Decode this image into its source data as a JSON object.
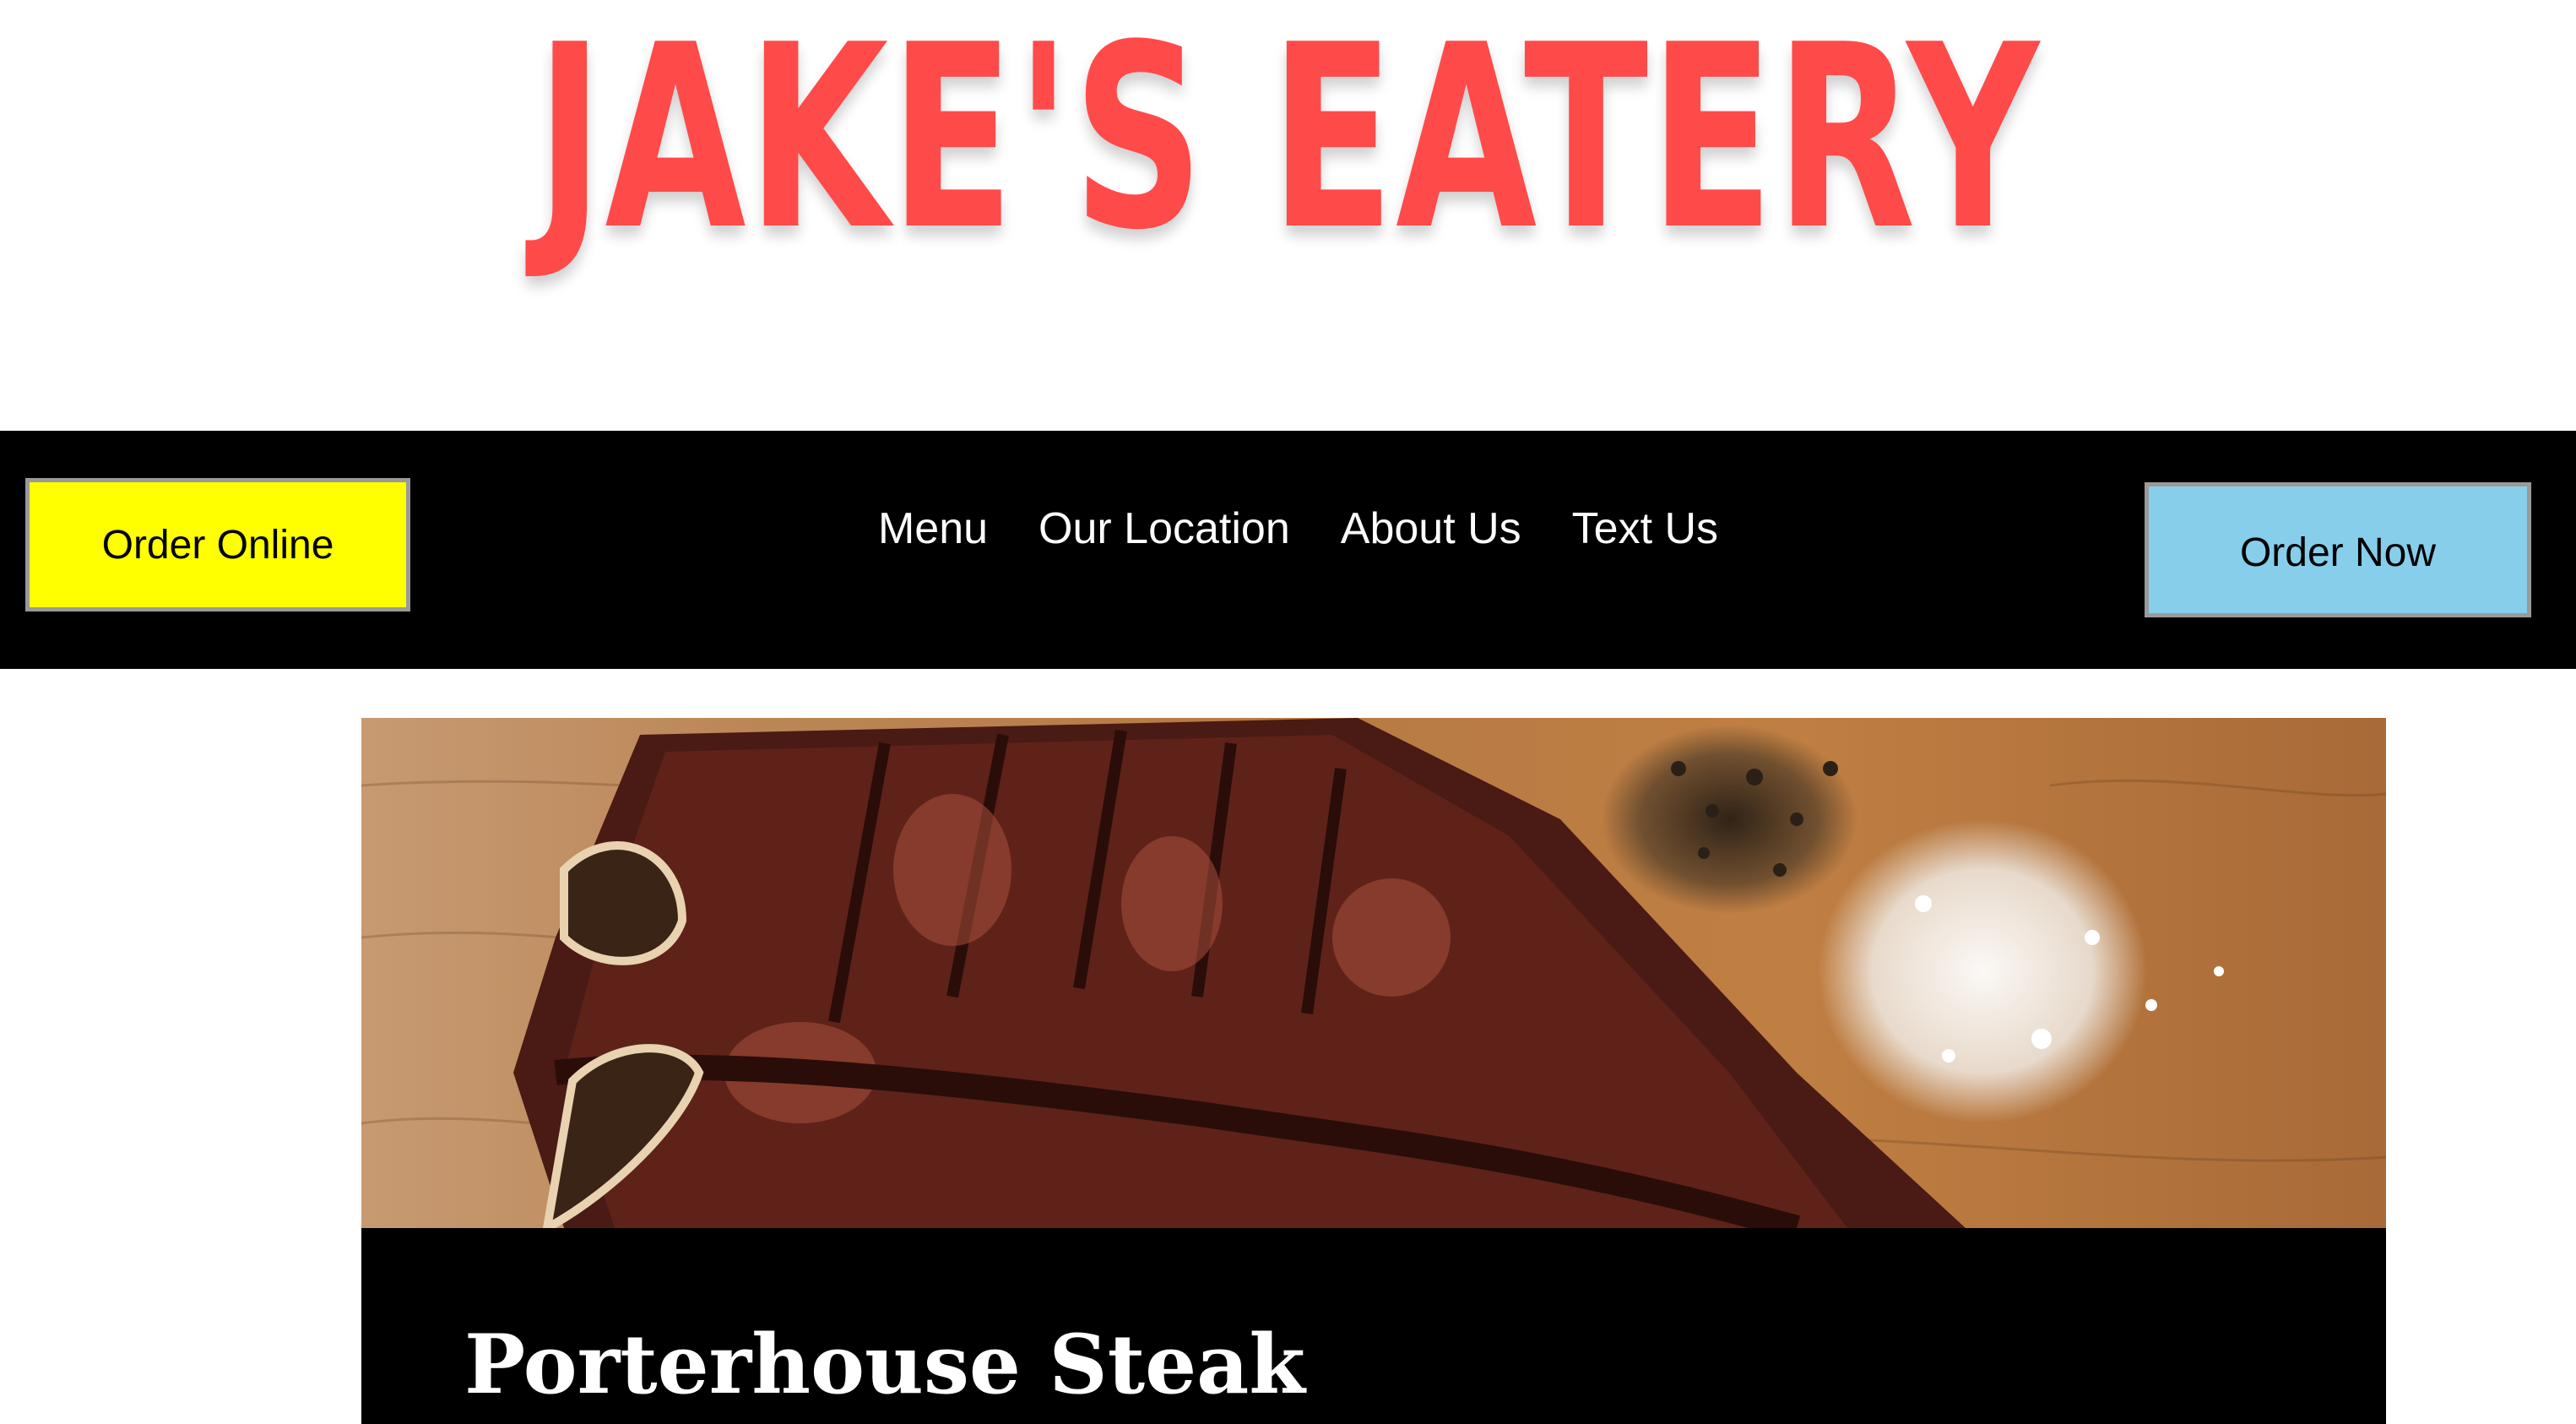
{
  "logo": {
    "text": "JAKE'S EATERY"
  },
  "nav": {
    "order_online_label": "Order Online",
    "order_now_label": "Order Now",
    "links": [
      "Menu",
      "Our Location",
      "About Us",
      "Text Us"
    ]
  },
  "featured": {
    "title": "Porterhouse Steak"
  },
  "colors": {
    "brand_red": "#ff4a4a",
    "order_online_bg": "#ffff00",
    "order_now_bg": "#87ceeb",
    "nav_bg": "#000000"
  }
}
